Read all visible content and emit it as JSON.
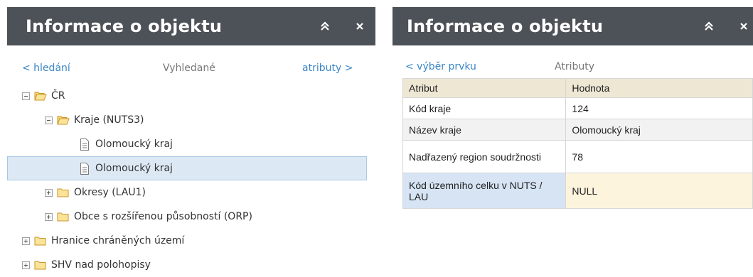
{
  "left_panel": {
    "title": "Informace o objektu",
    "nav": {
      "back": "< hledání",
      "middle": "Vyhledané",
      "forward": "atributy >"
    },
    "tree": [
      {
        "label": "ČR",
        "depth": 0,
        "kind": "folder-open",
        "toggle": "minus"
      },
      {
        "label": "Kraje (NUTS3)",
        "depth": 1,
        "kind": "folder-open",
        "toggle": "minus"
      },
      {
        "label": "Olomoucký kraj",
        "depth": 2,
        "kind": "doc",
        "toggle": "none"
      },
      {
        "label": "Olomoucký kraj",
        "depth": 2,
        "kind": "doc",
        "toggle": "none",
        "selected": true
      },
      {
        "label": "Okresy (LAU1)",
        "depth": 1,
        "kind": "folder",
        "toggle": "plus"
      },
      {
        "label": "Obce s rozšířenou působností (ORP)",
        "depth": 1,
        "kind": "folder",
        "toggle": "plus"
      },
      {
        "label": "Hranice chráněných území",
        "depth": 0,
        "kind": "folder",
        "toggle": "plus"
      },
      {
        "label": "SHV nad polohopisy",
        "depth": 0,
        "kind": "folder",
        "toggle": "plus"
      }
    ]
  },
  "right_panel": {
    "title": "Informace o objektu",
    "nav": {
      "back": "< výběr prvku",
      "middle": "Atributy"
    },
    "table": {
      "headers": [
        "Atribut",
        "Hodnota"
      ],
      "rows": [
        {
          "attr": "Kód kraje",
          "value": "124"
        },
        {
          "attr": "Název kraje",
          "value": "Olomoucký kraj"
        },
        {
          "attr": "Nadřazený region soudržnosti",
          "value": "78"
        },
        {
          "attr": "Kód územního celku v NUTS / LAU",
          "value": "NULL"
        }
      ]
    }
  },
  "colors": {
    "header_bg": "#4d5258",
    "link": "#3b86c6",
    "selected_row_bg": "#dce9f5",
    "table_header_bg": "#ede7d4",
    "folder": "#e8b93a"
  },
  "icons": {
    "collapse": "double-chevron-up-icon",
    "close": "close-icon",
    "folder": "folder-icon",
    "folder_open": "folder-open-icon",
    "document": "document-icon"
  }
}
